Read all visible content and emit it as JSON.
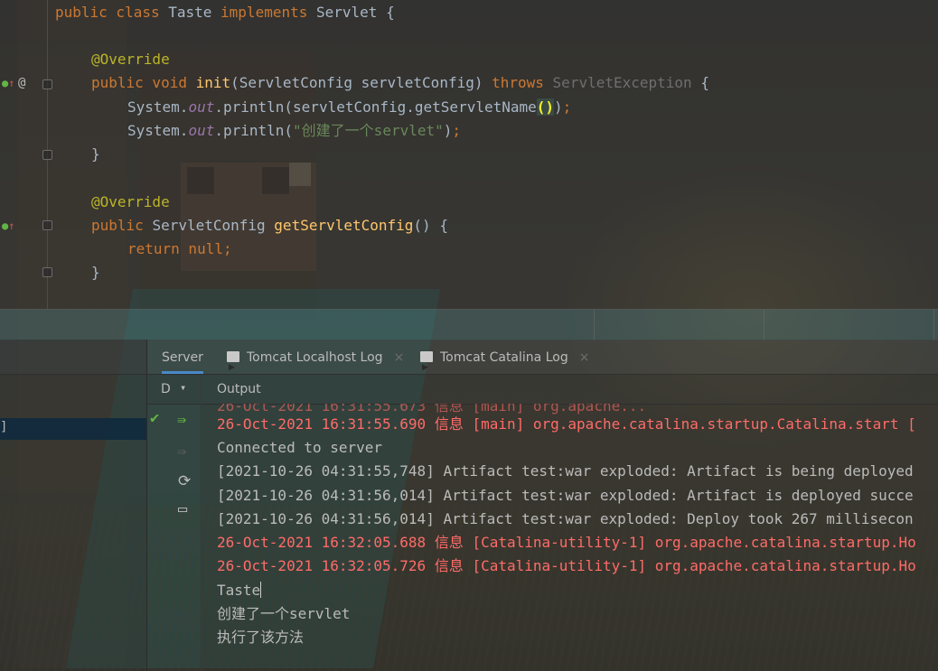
{
  "editor": {
    "lines": [
      {
        "parts": [
          [
            "kw",
            "public class "
          ],
          [
            "",
            "Taste "
          ],
          [
            "kw",
            "implements "
          ],
          [
            "",
            "Servlet {"
          ]
        ]
      },
      {
        "parts": [
          [
            "ann",
            "@Override"
          ]
        ]
      },
      {
        "parts": [
          [
            "kw",
            "public void "
          ],
          [
            "fn",
            "init"
          ],
          [
            "",
            "(ServletConfig servletConfig) "
          ],
          [
            "kw",
            "throws "
          ],
          [
            "dim",
            "ServletException "
          ],
          [
            "",
            "{"
          ]
        ]
      },
      {
        "parts": [
          [
            "",
            "System."
          ],
          [
            "fld",
            "out"
          ],
          [
            "",
            ".println(servletConfig.getServletName"
          ],
          [
            "pbr",
            "()"
          ],
          [
            "",
            ")"
          ],
          [
            "kw",
            ";"
          ]
        ]
      },
      {
        "parts": [
          [
            "",
            "System."
          ],
          [
            "fld",
            "out"
          ],
          [
            "",
            ".println("
          ],
          [
            "str",
            "\"创建了一个servlet\""
          ],
          [
            "",
            ")"
          ],
          [
            "kw",
            ";"
          ]
        ]
      },
      {
        "parts": [
          [
            "",
            "}"
          ]
        ]
      },
      {
        "parts": [
          [
            "ann",
            "@Override"
          ]
        ]
      },
      {
        "parts": [
          [
            "kw",
            "public "
          ],
          [
            "",
            "ServletConfig "
          ],
          [
            "fn",
            "getServletConfig"
          ],
          [
            "",
            "() {"
          ]
        ]
      },
      {
        "parts": [
          [
            "kw",
            "return null;"
          ]
        ]
      },
      {
        "parts": [
          [
            "",
            "}"
          ]
        ]
      }
    ],
    "gutter": {
      "override_marker": "@",
      "implements_icon": "implements-icon"
    }
  },
  "tabs": [
    {
      "label": "Server"
    },
    {
      "label": "Tomcat Localhost Log",
      "close": "×"
    },
    {
      "label": "Tomcat Catalina Log",
      "close": "×"
    }
  ],
  "output": {
    "deploy_label": "D",
    "chevron": "⌄",
    "title": "Output",
    "lines": [
      {
        "color": "red",
        "text": "26-Oct-2021 16:31:55.690 信息 [main] org.apache.catalina.startup.Catalina.start ["
      },
      {
        "color": "",
        "text": "Connected to server"
      },
      {
        "color": "",
        "text": "[2021-10-26 04:31:55,748] Artifact test:war exploded: Artifact is being deployed"
      },
      {
        "color": "",
        "text": "[2021-10-26 04:31:56,014] Artifact test:war exploded: Artifact is deployed succe"
      },
      {
        "color": "",
        "text": "[2021-10-26 04:31:56,014] Artifact test:war exploded: Deploy took 267 millisecon"
      },
      {
        "color": "red",
        "text": "26-Oct-2021 16:32:05.688 信息 [Catalina-utility-1] org.apache.catalina.startup.Ho"
      },
      {
        "color": "red",
        "text": "26-Oct-2021 16:32:05.726 信息 [Catalina-utility-1] org.apache.catalina.startup.Ho"
      },
      {
        "color": "",
        "text": "Taste"
      },
      {
        "color": "",
        "text": "创建了一个servlet"
      },
      {
        "color": "",
        "text": "执行了该方法"
      }
    ]
  },
  "left_panel": {
    "selected_fragment": "]"
  },
  "colors": {
    "keyword": "#cc7832",
    "annotation": "#bbb529",
    "method": "#ffc66d",
    "string": "#6a8759",
    "error_text": "#ff6b68",
    "tab_accent": "#4a88c7"
  }
}
